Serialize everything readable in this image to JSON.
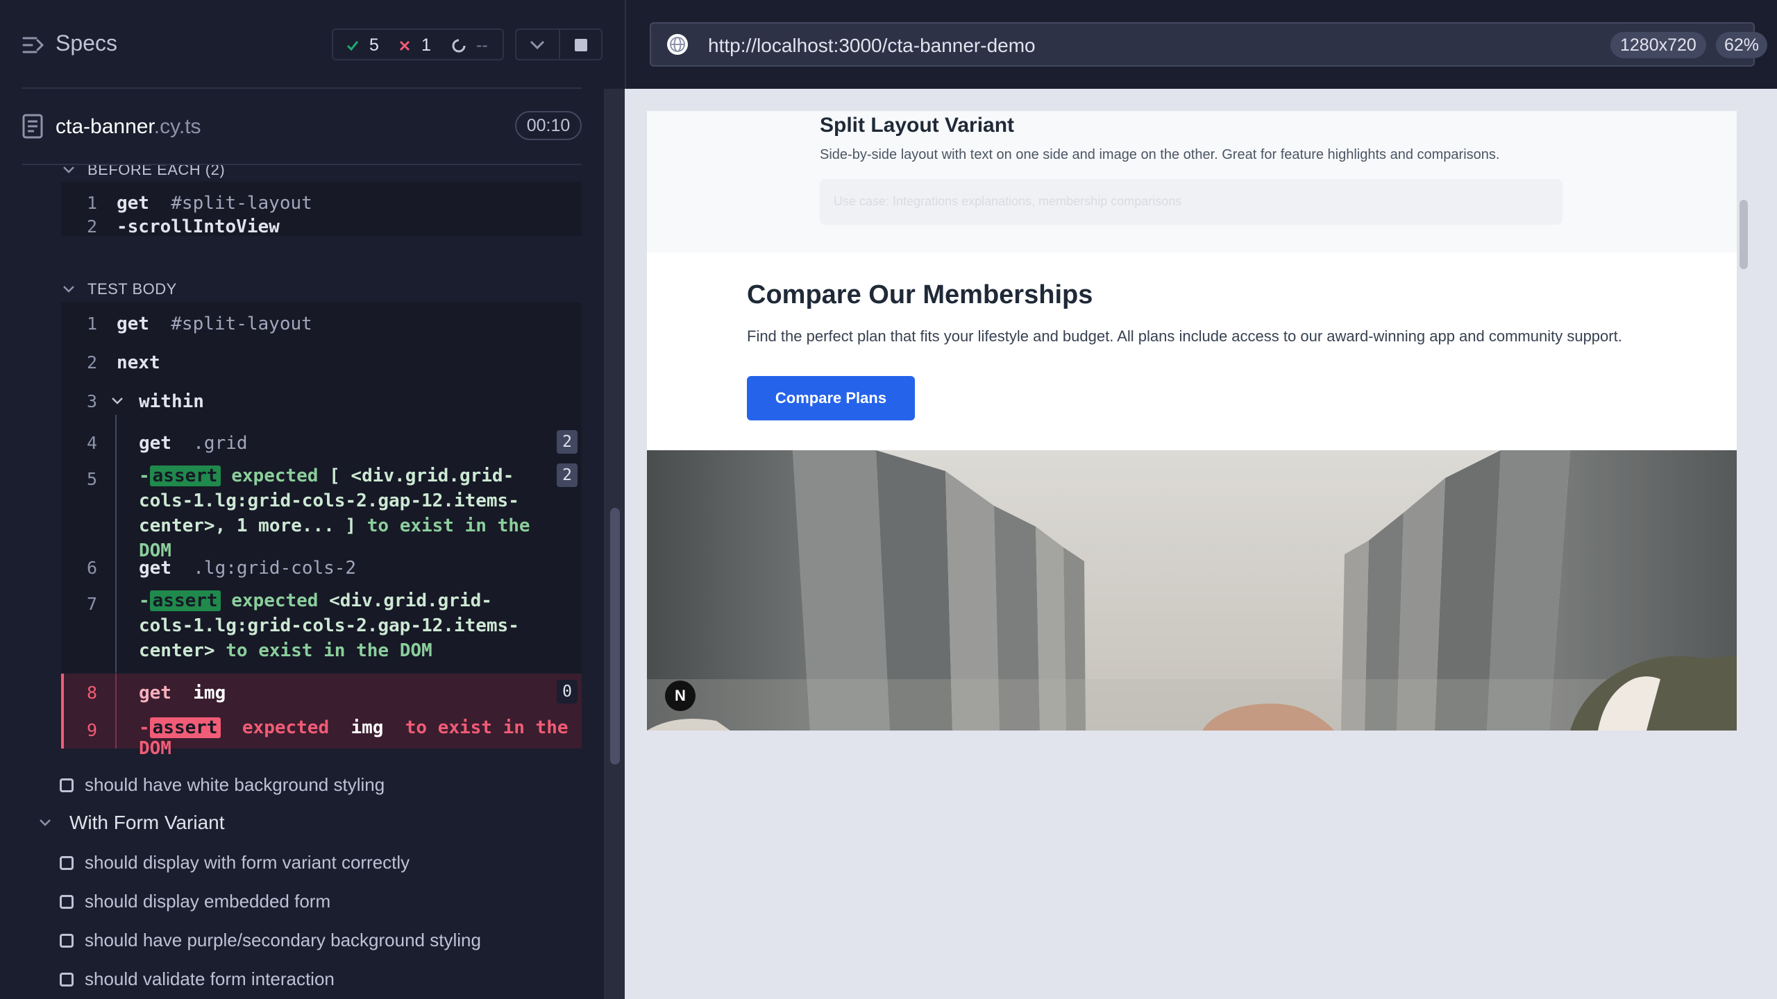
{
  "reporter": {
    "specs_label": "Specs",
    "stats": {
      "passed": "5",
      "failed": "1",
      "pending": "--"
    },
    "spec": {
      "name": "cta-banner",
      "ext": ".cy.ts",
      "duration": "00:10"
    },
    "before_each_label": "BEFORE EACH (2)",
    "before_each_commands": [
      {
        "num": "1",
        "name": "get",
        "arg": "#split-layout"
      },
      {
        "num": "2",
        "name": "-scrollIntoView",
        "arg": ""
      }
    ],
    "test_body_label": "TEST BODY",
    "test_body_commands": [
      {
        "num": "1",
        "name": "get",
        "arg": "#split-layout"
      },
      {
        "num": "2",
        "name": "next",
        "arg": ""
      },
      {
        "num": "3",
        "name": "within",
        "arg": ""
      },
      {
        "num": "4",
        "name": "get",
        "arg": ".grid",
        "count": "2"
      },
      {
        "num": "5",
        "prefix": "-",
        "tag": "assert",
        "w1": "expected",
        "em": "[ <div.grid.grid-cols-1.lg:grid-cols-2.gap-12.items-center>, 1 more... ]",
        "w2": "to exist in the DOM",
        "count": "2"
      },
      {
        "num": "6",
        "name": "get",
        "arg": ".lg:grid-cols-2"
      },
      {
        "num": "7",
        "prefix": "-",
        "tag": "assert",
        "w1": "expected",
        "em": "<div.grid.grid-cols-1.lg:grid-cols-2.gap-12.items-center>",
        "w2": "to exist in the DOM"
      },
      {
        "num": "8",
        "name": "get",
        "arg": "img",
        "count": "0"
      },
      {
        "num": "9",
        "prefix": "-",
        "tag": "assert",
        "w1": "expected",
        "em": "img",
        "w2": "to exist in the DOM"
      }
    ],
    "tests": [
      "should have white background styling"
    ],
    "suite": "With Form Variant",
    "suite_tests": [
      "should display with form variant correctly",
      "should display embedded form",
      "should have purple/secondary background styling",
      "should validate form interaction"
    ]
  },
  "aut": {
    "url": "http://localhost:3000/cta-banner-demo",
    "viewport": "1280x720",
    "zoom": "62%"
  },
  "page": {
    "split_title": "Split Layout Variant",
    "split_desc": "Side-by-side layout with text on one side and image on the other. Great for feature highlights and comparisons.",
    "use_case": "Use case: Integrations explanations, membership comparisons",
    "compare_title": "Compare Our Memberships",
    "compare_desc": "Find the perfect plan that fits your lifestyle and budget. All plans include access to our award-winning app and community support.",
    "compare_button": "Compare Plans",
    "next_badge": "N"
  },
  "colors": {
    "pass": "#1fa971",
    "fail": "#f15c76",
    "cta": "#2563eb",
    "reporter_bg": "#1b1e2e"
  }
}
